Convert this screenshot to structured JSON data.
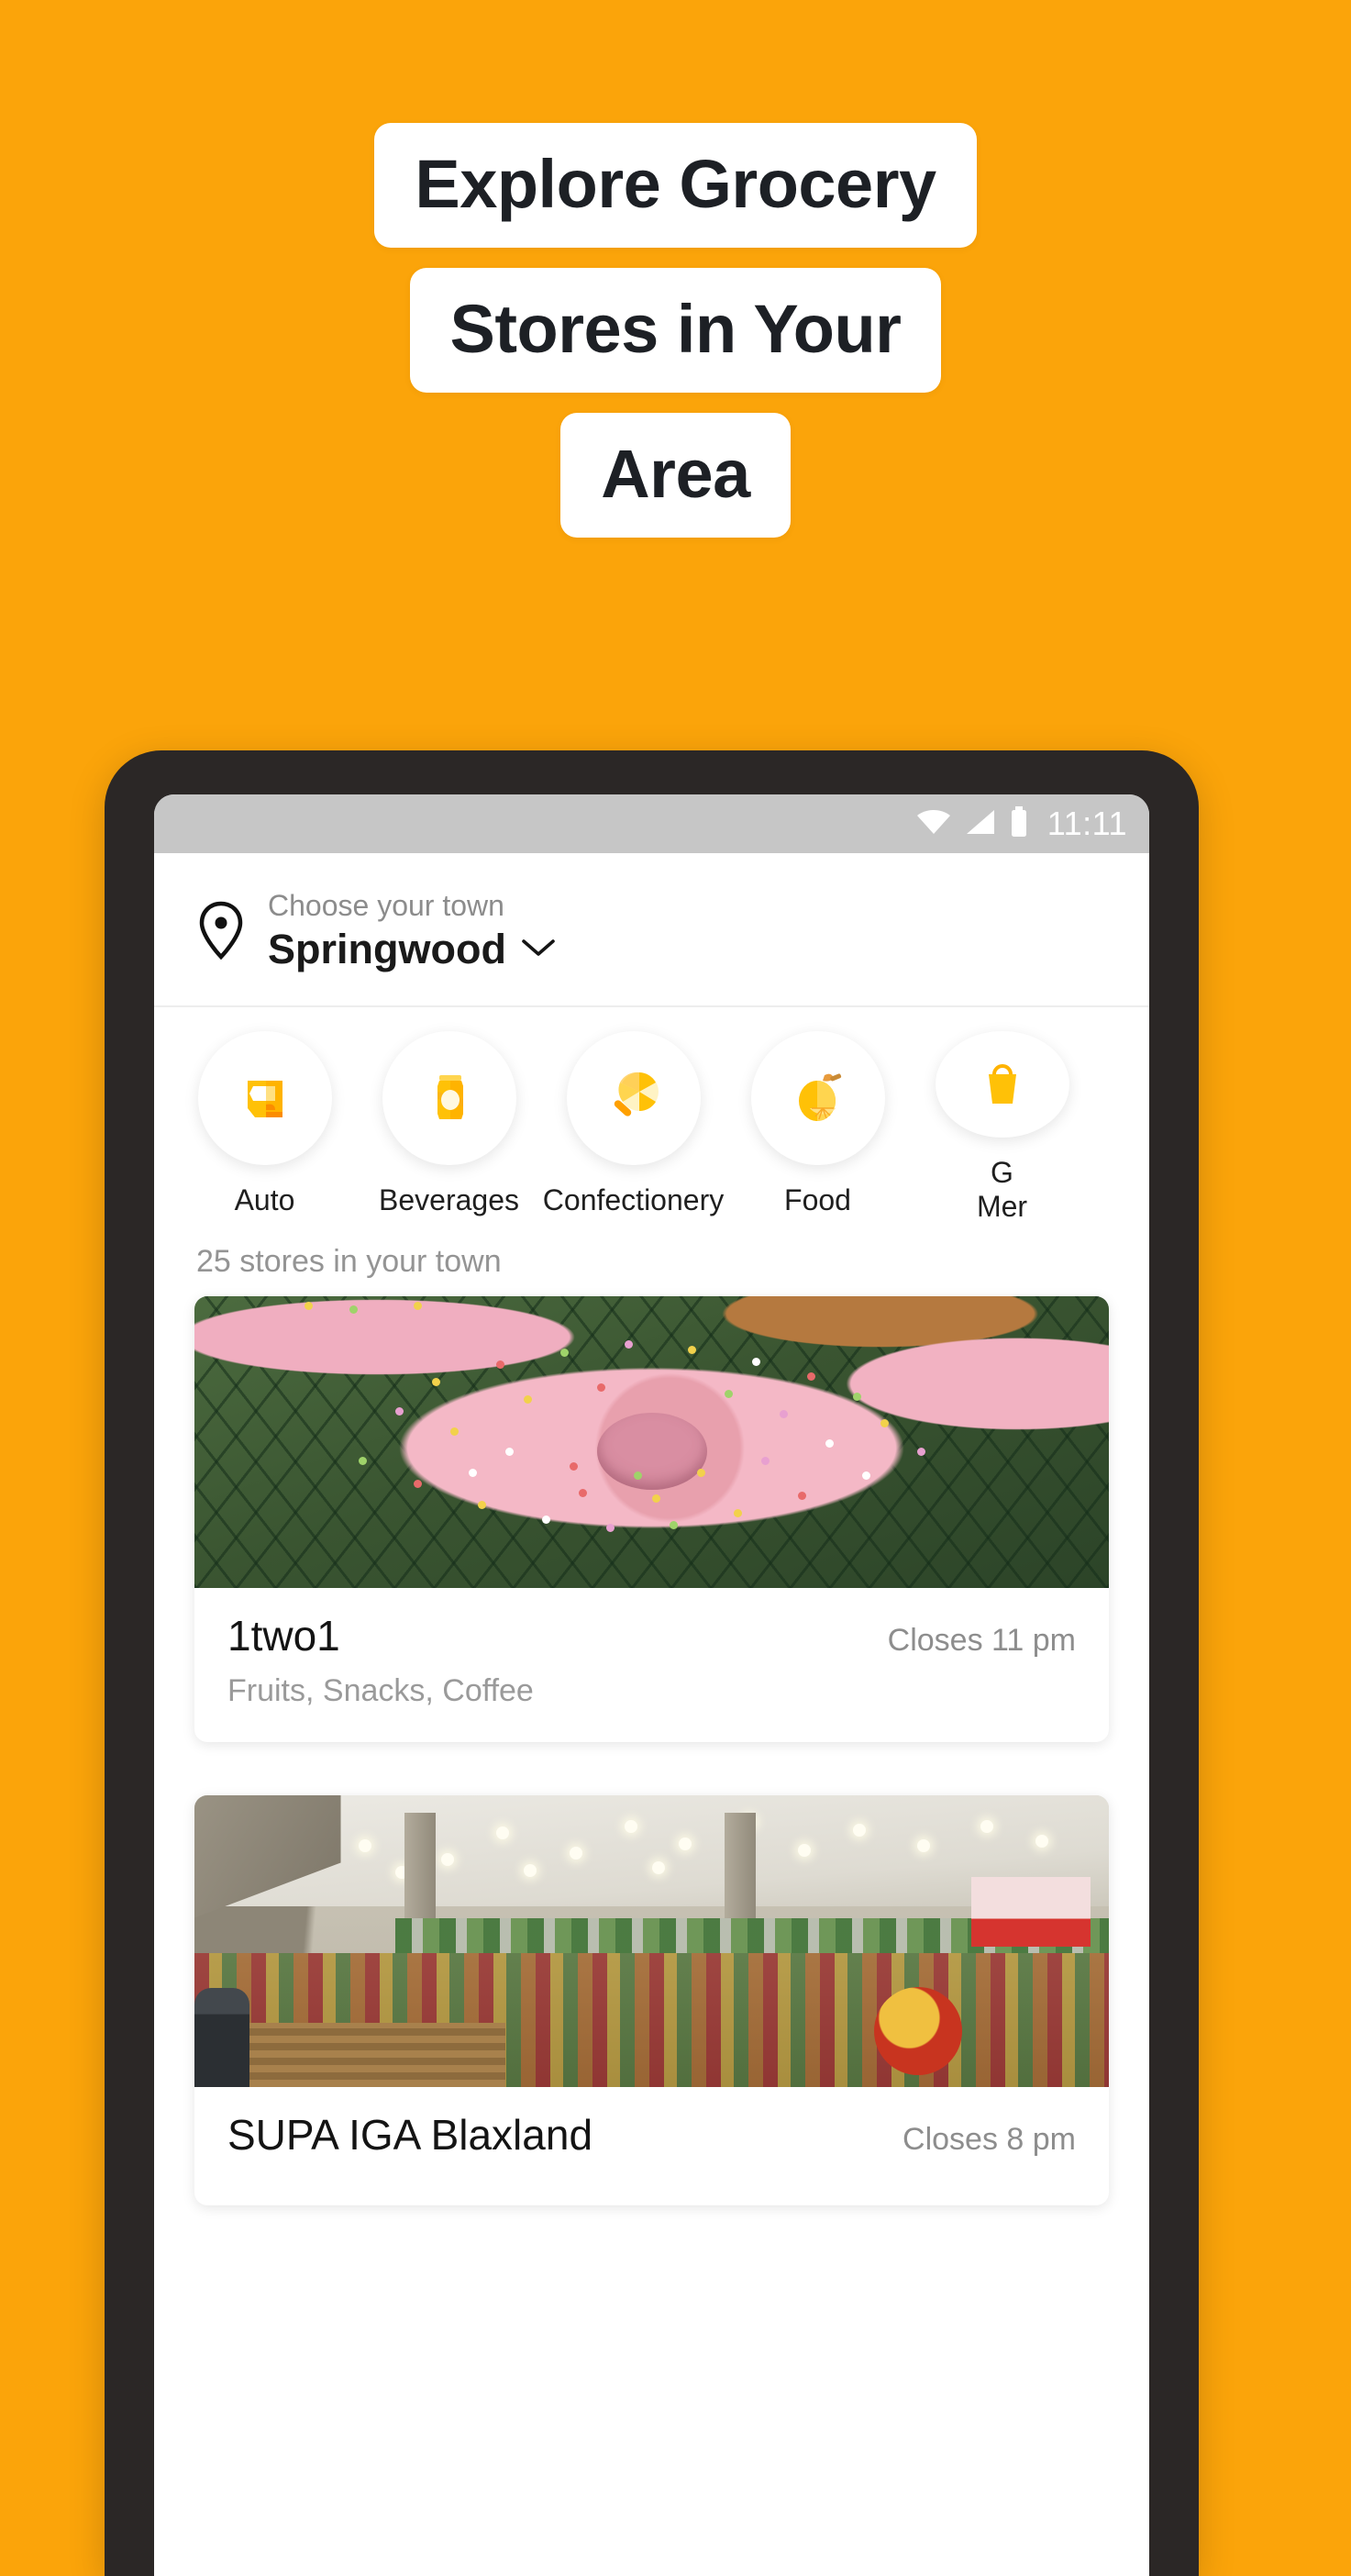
{
  "theme": {
    "background": "#FBA40A",
    "headline_box_bg": "#FFFFFF",
    "headline_text": "#1D2025",
    "phone_bezel": "#2B2726",
    "statusbar_bg": "#C6C6C6",
    "accent_icon": "#FFC107",
    "muted_text": "#949494"
  },
  "headline": {
    "lines": [
      "Explore Grocery",
      "Stores in Your",
      "Area"
    ]
  },
  "phone": {
    "statusbar": {
      "wifi_icon": "wifi-icon",
      "signal_icon": "cellular-signal-icon",
      "battery_icon": "battery-icon",
      "time": "11:11"
    },
    "location_header": {
      "pin_icon": "location-pin-icon",
      "caption": "Choose your town",
      "town": "Springwood",
      "chevron_icon": "chevron-down-icon"
    },
    "categories": [
      {
        "label": "Auto",
        "icon": "car-door-icon"
      },
      {
        "label": "Beverages",
        "icon": "soda-can-icon"
      },
      {
        "label": "Confectionery",
        "icon": "lollipop-icon"
      },
      {
        "label": "Food",
        "icon": "lemon-icon"
      },
      {
        "label": "G\nMer",
        "icon": "general-merchandise-icon"
      }
    ],
    "store_list": {
      "count_label": "25 stores in your town",
      "stores": [
        {
          "name": "1two1",
          "hours": "Closes 11 pm",
          "categories": "Fruits, Snacks, Coffee",
          "photo": "pink-sprinkled-donuts-photo"
        },
        {
          "name": "SUPA IGA Blaxland",
          "hours": "Closes 8 pm",
          "categories": "",
          "photo": "supermarket-produce-aisle-photo"
        }
      ]
    }
  }
}
